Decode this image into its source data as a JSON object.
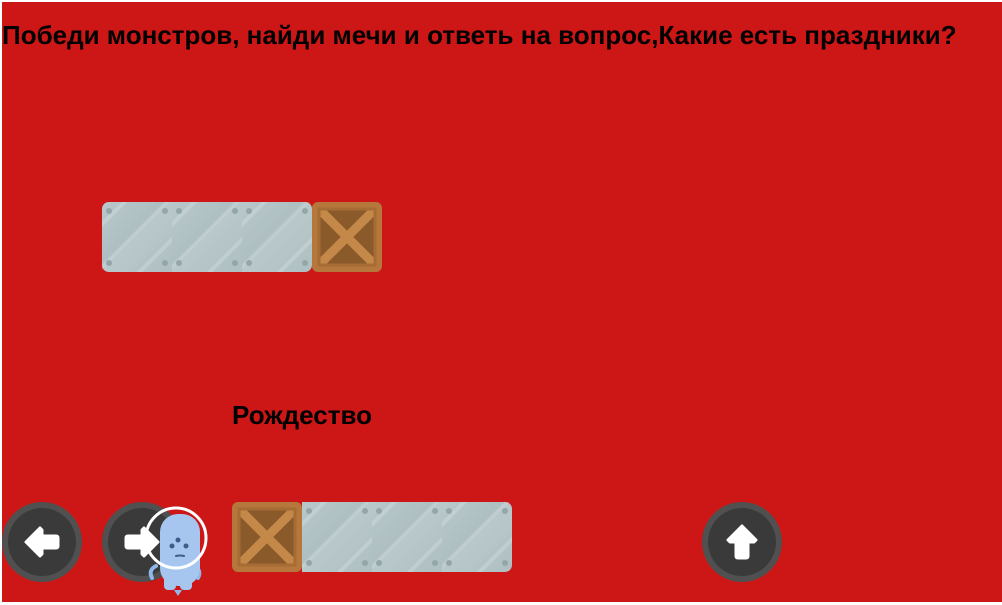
{
  "game": {
    "question": "Победи монстров, найди мечи и ответь на вопрос,Какие есть праздники?",
    "answer": "Рождество",
    "background_color": "#cd1616"
  },
  "controls": {
    "left_icon": "arrow-left-icon",
    "right_icon": "arrow-right-icon",
    "jump_icon": "arrow-up-icon"
  },
  "sprites": {
    "player": "blue-alien-player",
    "crate": "wooden-crate",
    "metal": "metal-plate"
  }
}
